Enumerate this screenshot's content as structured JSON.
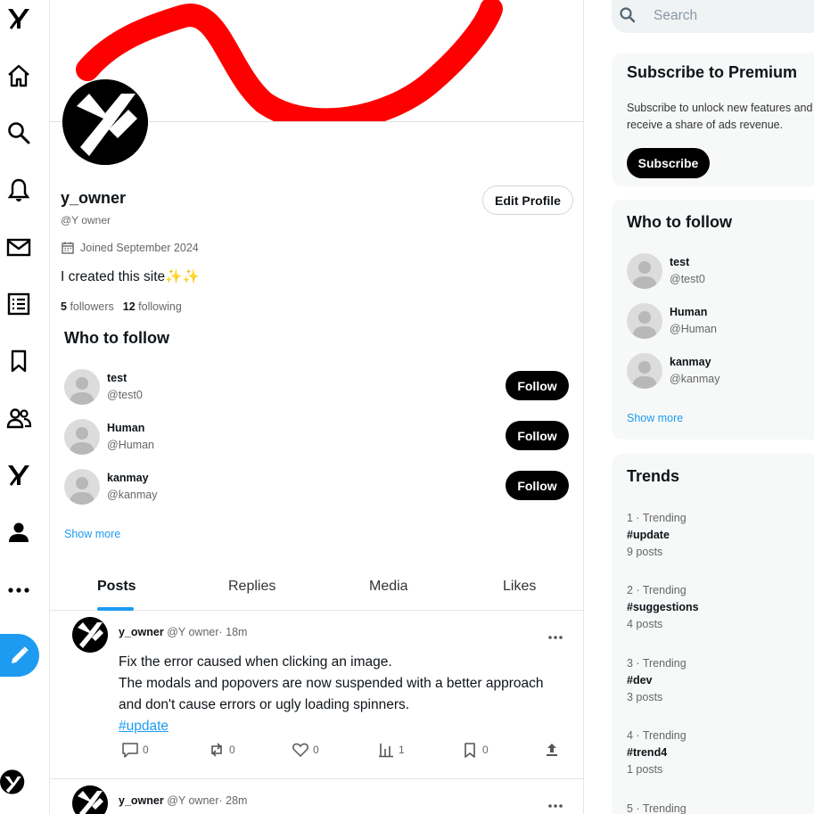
{
  "app": {
    "name": "Y"
  },
  "rail": {
    "items": [
      {
        "icon": "logo-y-icon"
      },
      {
        "icon": "home-icon"
      },
      {
        "icon": "search-icon"
      },
      {
        "icon": "bell-icon"
      },
      {
        "icon": "mail-icon"
      },
      {
        "icon": "list-icon"
      },
      {
        "icon": "bookmark-icon"
      },
      {
        "icon": "people-icon"
      },
      {
        "icon": "premium-y-icon"
      },
      {
        "icon": "person-icon"
      },
      {
        "icon": "more-icon"
      }
    ],
    "compose_icon": "pencil-icon",
    "accent": "#1d9bf0"
  },
  "profile": {
    "name": "y_owner",
    "handle": "@Y owner",
    "joined": "Joined September 2024",
    "bio": "I created this site✨✨",
    "followers_count": "5",
    "followers_label": "followers",
    "following_count": "12",
    "following_label": "following",
    "edit_label": "Edit Profile"
  },
  "who_to_follow_main": {
    "title": "Who to follow",
    "users": [
      {
        "name": "test",
        "handle": "@test0",
        "button": "Follow"
      },
      {
        "name": "Human",
        "handle": "@Human",
        "button": "Follow"
      },
      {
        "name": "kanmay",
        "handle": "@kanmay",
        "button": "Follow"
      }
    ],
    "show_more": "Show more"
  },
  "tabs": [
    {
      "label": "Posts",
      "active": true
    },
    {
      "label": "Replies",
      "active": false
    },
    {
      "label": "Media",
      "active": false
    },
    {
      "label": "Likes",
      "active": false
    }
  ],
  "posts": [
    {
      "author": "y_owner",
      "handle_time": "@Y owner· 18m",
      "lines": [
        "Fix the error caused when clicking an image.",
        "The modals and popovers are now suspended with a better approach",
        "and don't cause errors or ugly loading spinners."
      ],
      "hashtag": "#update",
      "replies": "0",
      "reposts": "0",
      "likes": "0",
      "views": "1",
      "bookmarks": "0"
    },
    {
      "author": "y_owner",
      "handle_time": "@Y owner· 28m"
    }
  ],
  "sidebar": {
    "search_placeholder": "Search",
    "premium": {
      "title": "Subscribe to Premium",
      "line1": "Subscribe to unlock new features and",
      "line2": "receive a share of ads revenue.",
      "button": "Subscribe"
    },
    "who_to_follow": {
      "title": "Who to follow",
      "users": [
        {
          "name": "test",
          "handle": "@test0"
        },
        {
          "name": "Human",
          "handle": "@Human"
        },
        {
          "name": "kanmay",
          "handle": "@kanmay"
        }
      ],
      "show_more": "Show more"
    },
    "trends": {
      "title": "Trends",
      "items": [
        {
          "meta": "1 · Trending",
          "tag": "#update",
          "count": "9 posts"
        },
        {
          "meta": "2 · Trending",
          "tag": "#suggestions",
          "count": "4 posts"
        },
        {
          "meta": "3 · Trending",
          "tag": "#dev",
          "count": "3 posts"
        },
        {
          "meta": "4 · Trending",
          "tag": "#trend4",
          "count": "1 posts"
        },
        {
          "meta": "5 · Trending",
          "tag": "",
          "count": ""
        }
      ]
    }
  }
}
